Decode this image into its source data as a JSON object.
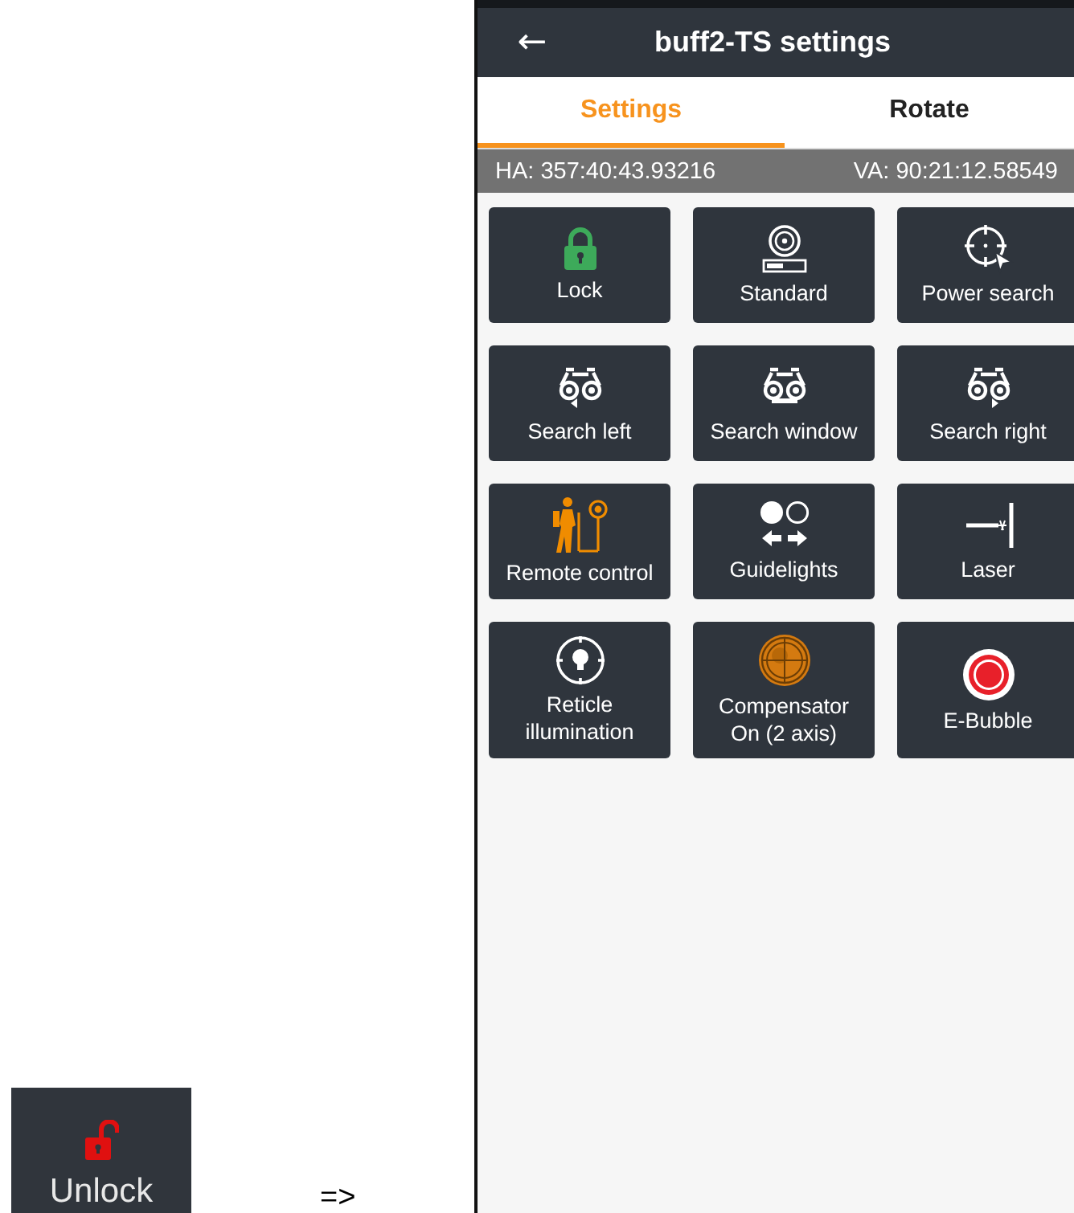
{
  "example_tile": {
    "label": "Unlock"
  },
  "arrow_note": "=>",
  "header": {
    "back": "←",
    "title": "buff2-TS settings"
  },
  "tabs": [
    {
      "label": "Settings",
      "selected": true
    },
    {
      "label": "Rotate",
      "selected": false
    }
  ],
  "angles": {
    "ha": "HA: 357:40:43.93216",
    "va": "VA: 90:21:12.58549"
  },
  "tiles": [
    {
      "label": "Lock"
    },
    {
      "label": "Standard"
    },
    {
      "label": "Power search"
    },
    {
      "label": "Search left"
    },
    {
      "label": "Search window"
    },
    {
      "label": "Search right"
    },
    {
      "label": "Remote control"
    },
    {
      "label": "Guidelights"
    },
    {
      "label": "Laser"
    },
    {
      "label": "Reticle illumination"
    },
    {
      "label": "Compensator On (2 axis)"
    },
    {
      "label": "E-Bubble"
    }
  ]
}
